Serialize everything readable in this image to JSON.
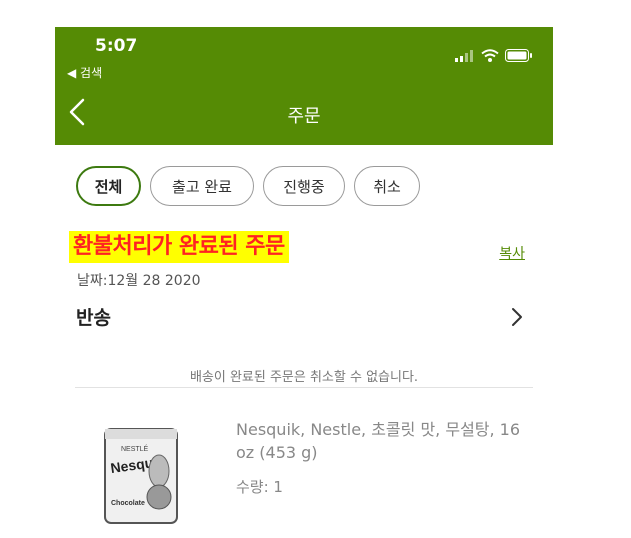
{
  "status_bar": {
    "time": "5:07",
    "back_app": "◀ 검색"
  },
  "nav": {
    "title": "주문"
  },
  "filters": [
    {
      "label": "전체",
      "active": true
    },
    {
      "label": "출고 완료",
      "active": false
    },
    {
      "label": "진행중",
      "active": false
    },
    {
      "label": "취소",
      "active": false
    }
  ],
  "order": {
    "highlight": "환불처리가 완료된 주문",
    "copy_label": "복사",
    "date": "날짜:12월 28 2020",
    "status": "반송",
    "notice": "배송이 완료된 주문은 취소할 수 없습니다.",
    "product": {
      "name": "Nesquik, Nestle, 초콜릿 맛, 무설탕, 16 oz (453 g)",
      "quantity": "수량: 1",
      "image_brand": "Nesquik",
      "image_maker": "NESTLÉ",
      "image_flavor": "Chocolate"
    }
  },
  "colors": {
    "header": "#558b05",
    "highlight_bg": "#ffff00",
    "highlight_text": "#ff2222"
  },
  "icons": [
    "signal-icon",
    "wifi-icon",
    "battery-icon",
    "back-chevron-icon",
    "chevron-right-icon"
  ]
}
